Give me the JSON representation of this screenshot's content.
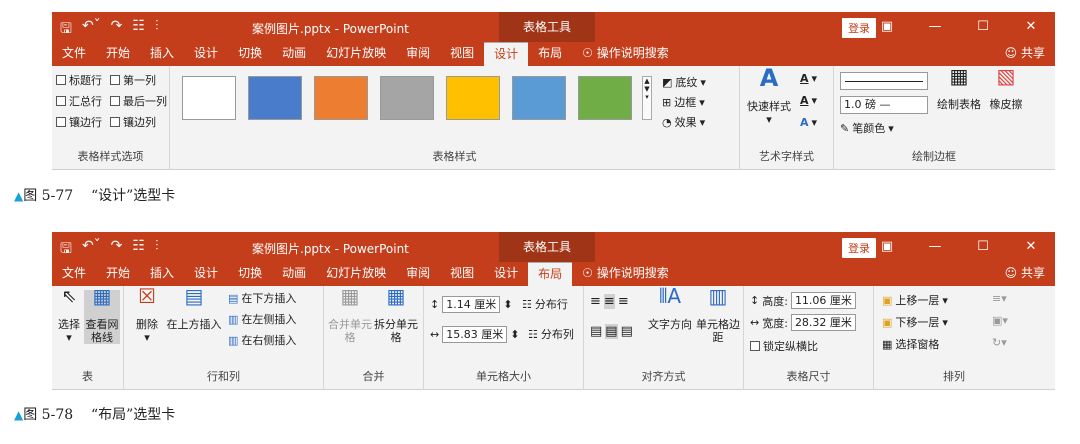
{
  "app_doc": "案例图片.pptx - PowerPoint",
  "context_tab": "表格工具",
  "login": "登录",
  "tabs": [
    "文件",
    "开始",
    "插入",
    "设计",
    "切换",
    "动画",
    "幻灯片放映",
    "审阅",
    "视图",
    "设计",
    "布局"
  ],
  "tellme": "操作说明搜索",
  "share": "共享",
  "design": {
    "options": [
      "标题行",
      "第一列",
      "汇总行",
      "最后一列",
      "镶边行",
      "镶边列"
    ],
    "options_label": "表格样式选项",
    "styles_label": "表格样式",
    "shading": "底纹",
    "border": "边框",
    "effect": "效果",
    "quick_style": "快速样式",
    "wordart_label": "艺术字样式",
    "pen_weight": "1.0 磅",
    "pen_color": "笔颜色",
    "draw_table": "绘制表格",
    "eraser": "橡皮擦",
    "draw_border_label": "绘制边框",
    "swatch_colors": [
      "#ffffff",
      "#4a7ccc",
      "#ed7d31",
      "#a5a5a5",
      "#ffc000",
      "#5b9bd5",
      "#70ad47"
    ]
  },
  "layout": {
    "select": "选择",
    "gridlines": "查看网格线",
    "table_label": "表",
    "delete": "删除",
    "insert_above": "在上方插入",
    "insert_below": "在下方插入",
    "insert_left": "在左侧插入",
    "insert_right": "在右侧插入",
    "rowcol_label": "行和列",
    "merge": "合并单元格",
    "split": "拆分单元格",
    "merge_label": "合并",
    "height_val": "1.14 厘米",
    "width_val": "15.83 厘米",
    "dist_rows": "分布行",
    "dist_cols": "分布列",
    "cellsize_label": "单元格大小",
    "text_dir": "文字方向",
    "cell_margin": "单元格边距",
    "align_label": "对齐方式",
    "tbl_height_lbl": "高度:",
    "tbl_height": "11.06 厘米",
    "tbl_width_lbl": "宽度:",
    "tbl_width": "28.32 厘米",
    "lock_ratio": "锁定纵横比",
    "tblsize_label": "表格尺寸",
    "bring_forward": "上移一层",
    "send_backward": "下移一层",
    "selection_pane": "选择窗格",
    "arrange_label": "排列"
  },
  "captions": {
    "fig1_num": "图 5-77",
    "fig1_text": "“设计”选型卡",
    "fig2_num": "图 5-78",
    "fig2_text": "“布局”选型卡"
  }
}
